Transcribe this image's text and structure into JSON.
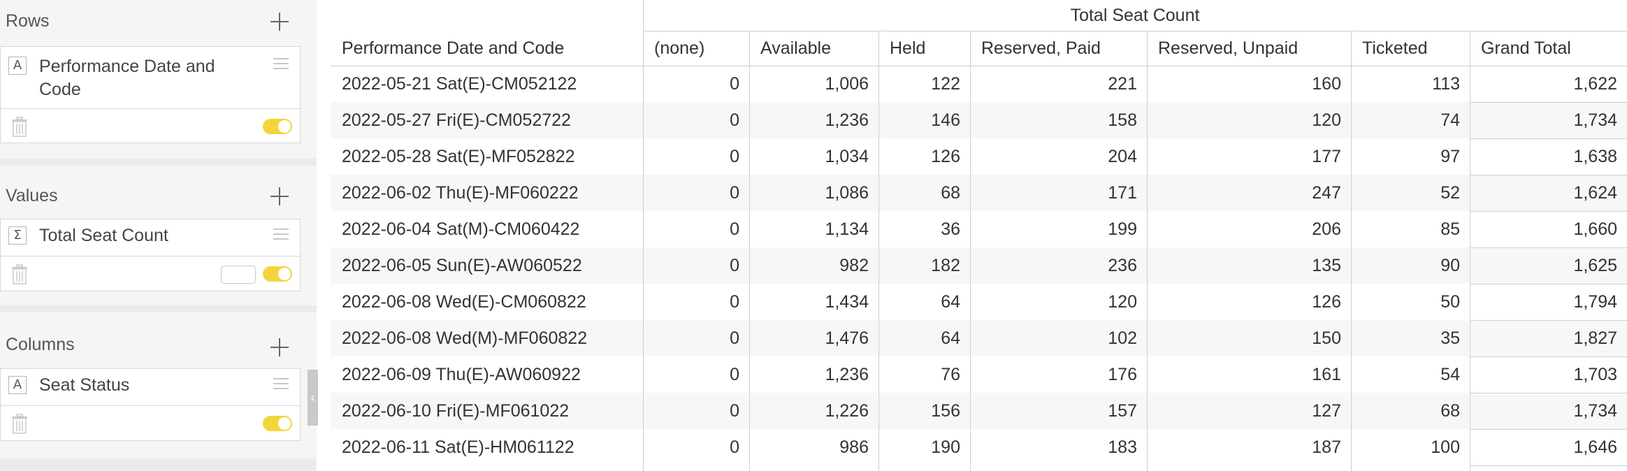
{
  "panel": {
    "rows": {
      "title": "Rows",
      "field": {
        "type_icon": "A",
        "name": "Performance Date and Code"
      }
    },
    "values": {
      "title": "Values",
      "field": {
        "type_icon": "Σ",
        "name": "Total Seat Count"
      }
    },
    "columns": {
      "title": "Columns",
      "field": {
        "type_icon": "A",
        "name": "Seat Status"
      }
    },
    "collapse_glyph": "‹",
    "toggle_color": "#f2d53c"
  },
  "table": {
    "value_header": "Total Seat Count",
    "row_header": "Performance Date and Code",
    "columns": [
      "(none)",
      "Available",
      "Held",
      "Reserved, Paid",
      "Reserved, Unpaid",
      "Ticketed",
      "Grand Total"
    ],
    "rows": [
      {
        "label": "2022-05-21 Sat(E)-CM052122",
        "values": [
          "0",
          "1,006",
          "122",
          "221",
          "160",
          "113",
          "1,622"
        ]
      },
      {
        "label": "2022-05-27 Fri(E)-CM052722",
        "values": [
          "0",
          "1,236",
          "146",
          "158",
          "120",
          "74",
          "1,734"
        ]
      },
      {
        "label": "2022-05-28 Sat(E)-MF052822",
        "values": [
          "0",
          "1,034",
          "126",
          "204",
          "177",
          "97",
          "1,638"
        ]
      },
      {
        "label": "2022-06-02 Thu(E)-MF060222",
        "values": [
          "0",
          "1,086",
          "68",
          "171",
          "247",
          "52",
          "1,624"
        ]
      },
      {
        "label": "2022-06-04 Sat(M)-CM060422",
        "values": [
          "0",
          "1,134",
          "36",
          "199",
          "206",
          "85",
          "1,660"
        ]
      },
      {
        "label": "2022-06-05 Sun(E)-AW060522",
        "values": [
          "0",
          "982",
          "182",
          "236",
          "135",
          "90",
          "1,625"
        ]
      },
      {
        "label": "2022-06-08 Wed(E)-CM060822",
        "values": [
          "0",
          "1,434",
          "64",
          "120",
          "126",
          "50",
          "1,794"
        ]
      },
      {
        "label": "2022-06-08 Wed(M)-MF060822",
        "values": [
          "0",
          "1,476",
          "64",
          "102",
          "150",
          "35",
          "1,827"
        ]
      },
      {
        "label": "2022-06-09 Thu(E)-AW060922",
        "values": [
          "0",
          "1,236",
          "76",
          "176",
          "161",
          "54",
          "1,703"
        ]
      },
      {
        "label": "2022-06-10 Fri(E)-MF061022",
        "values": [
          "0",
          "1,226",
          "156",
          "157",
          "127",
          "68",
          "1,734"
        ]
      },
      {
        "label": "2022-06-11 Sat(E)-HM061122",
        "values": [
          "0",
          "986",
          "190",
          "183",
          "187",
          "100",
          "1,646"
        ]
      }
    ],
    "stripe_color": "#f7f7f7",
    "grid_color": "#cfcfcf"
  }
}
